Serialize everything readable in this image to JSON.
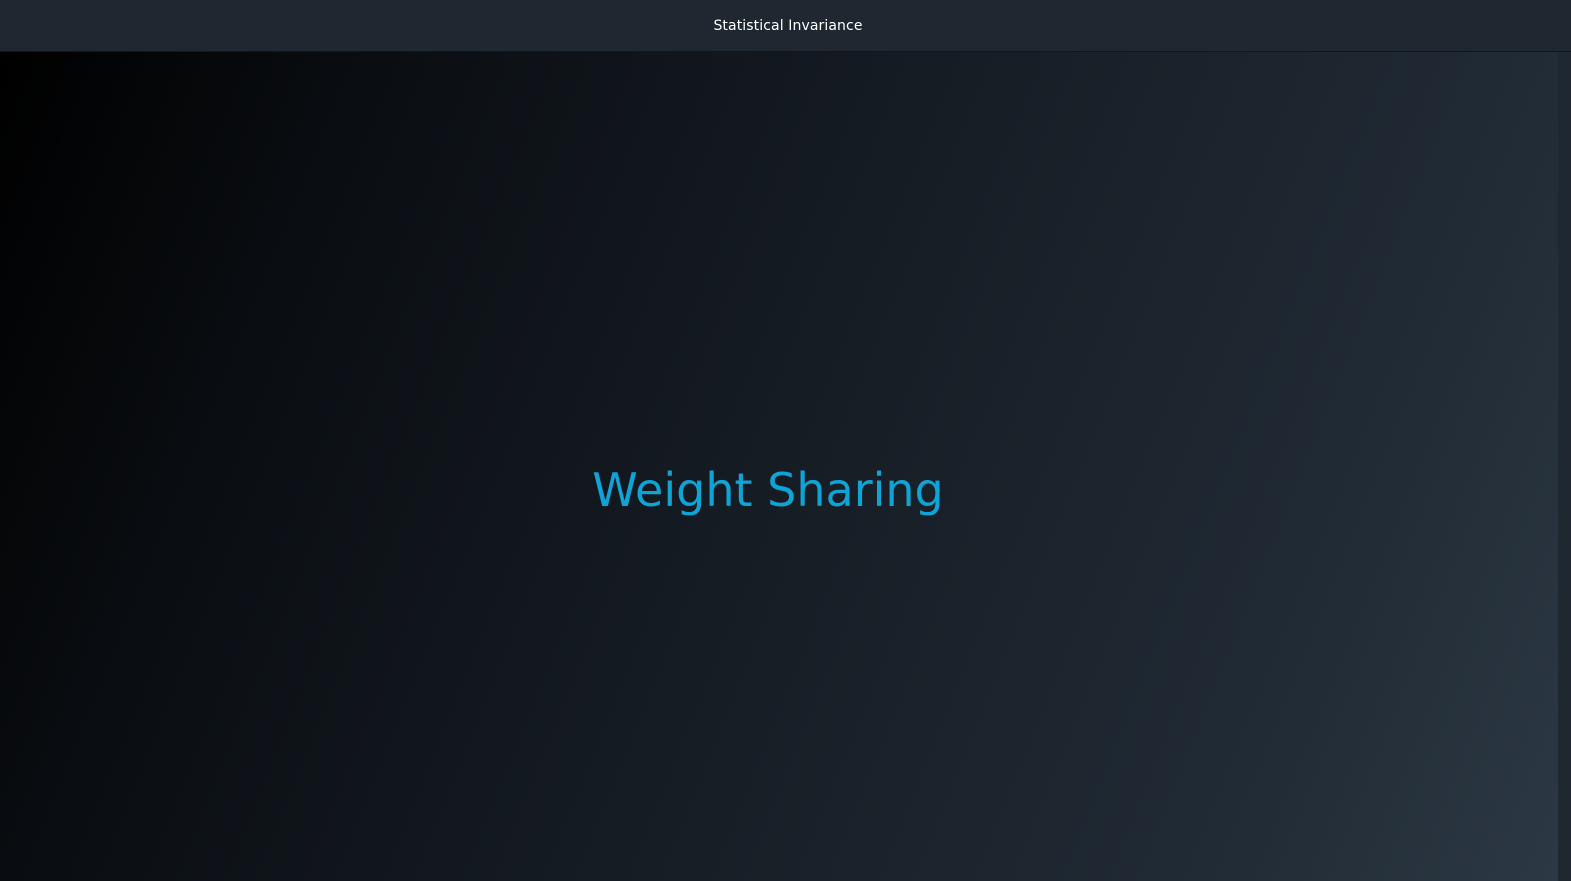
{
  "header": {
    "title": "Statistical Invariance"
  },
  "slide": {
    "heading": "Weight Sharing"
  },
  "colors": {
    "header_background": "#1f2831",
    "header_text": "#ffffff",
    "heading_accent": "#0ea4d6",
    "stage_dark": "#000000",
    "stage_light": "#2c3844"
  }
}
